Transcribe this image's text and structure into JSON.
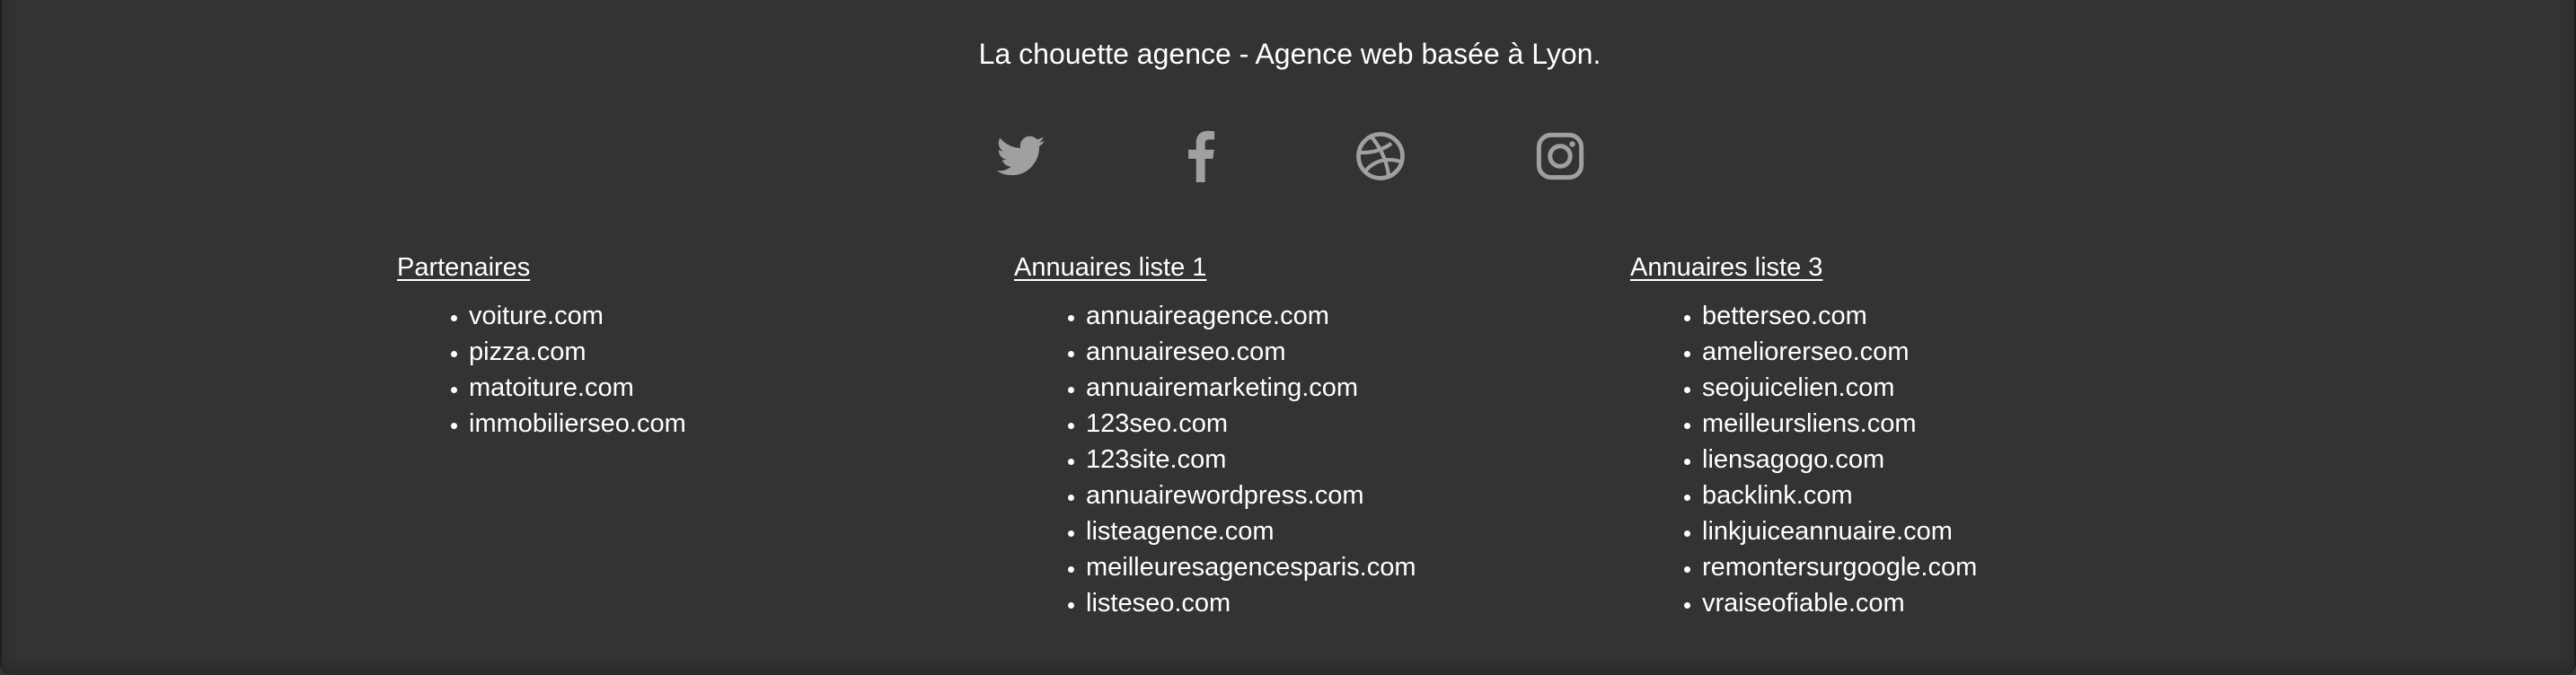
{
  "footer": {
    "tagline": "La chouette agence - Agence web basée à Lyon.",
    "social": [
      {
        "icon": "twitter-icon",
        "label": "Twitter"
      },
      {
        "icon": "facebook-icon",
        "label": "Facebook"
      },
      {
        "icon": "dribbble-icon",
        "label": "Dribbble"
      },
      {
        "icon": "instagram-icon",
        "label": "Instagram"
      }
    ],
    "columns": [
      {
        "title": "Partenaires",
        "links": [
          "voiture.com",
          "pizza.com",
          "matoiture.com",
          "immobilierseo.com"
        ]
      },
      {
        "title": "Annuaires liste 1",
        "links": [
          "annuaireagence.com",
          "annuaireseo.com",
          "annuairemarketing.com",
          "123seo.com",
          "123site.com",
          "annuairewordpress.com",
          "listeagence.com",
          "meilleuresagencesparis.com",
          "listeseo.com"
        ]
      },
      {
        "title": "Annuaires liste 3",
        "links": [
          "betterseo.com",
          "ameliorerseo.com",
          "seojuicelien.com",
          "meilleursliens.com",
          "liensagogo.com",
          "backlink.com",
          "linkjuiceannuaire.com",
          "remontersurgoogle.com",
          "vraiseofiable.com"
        ]
      }
    ]
  },
  "colors": {
    "background": "#333333",
    "text": "#ffffff",
    "icon": "#a0a0a0"
  }
}
